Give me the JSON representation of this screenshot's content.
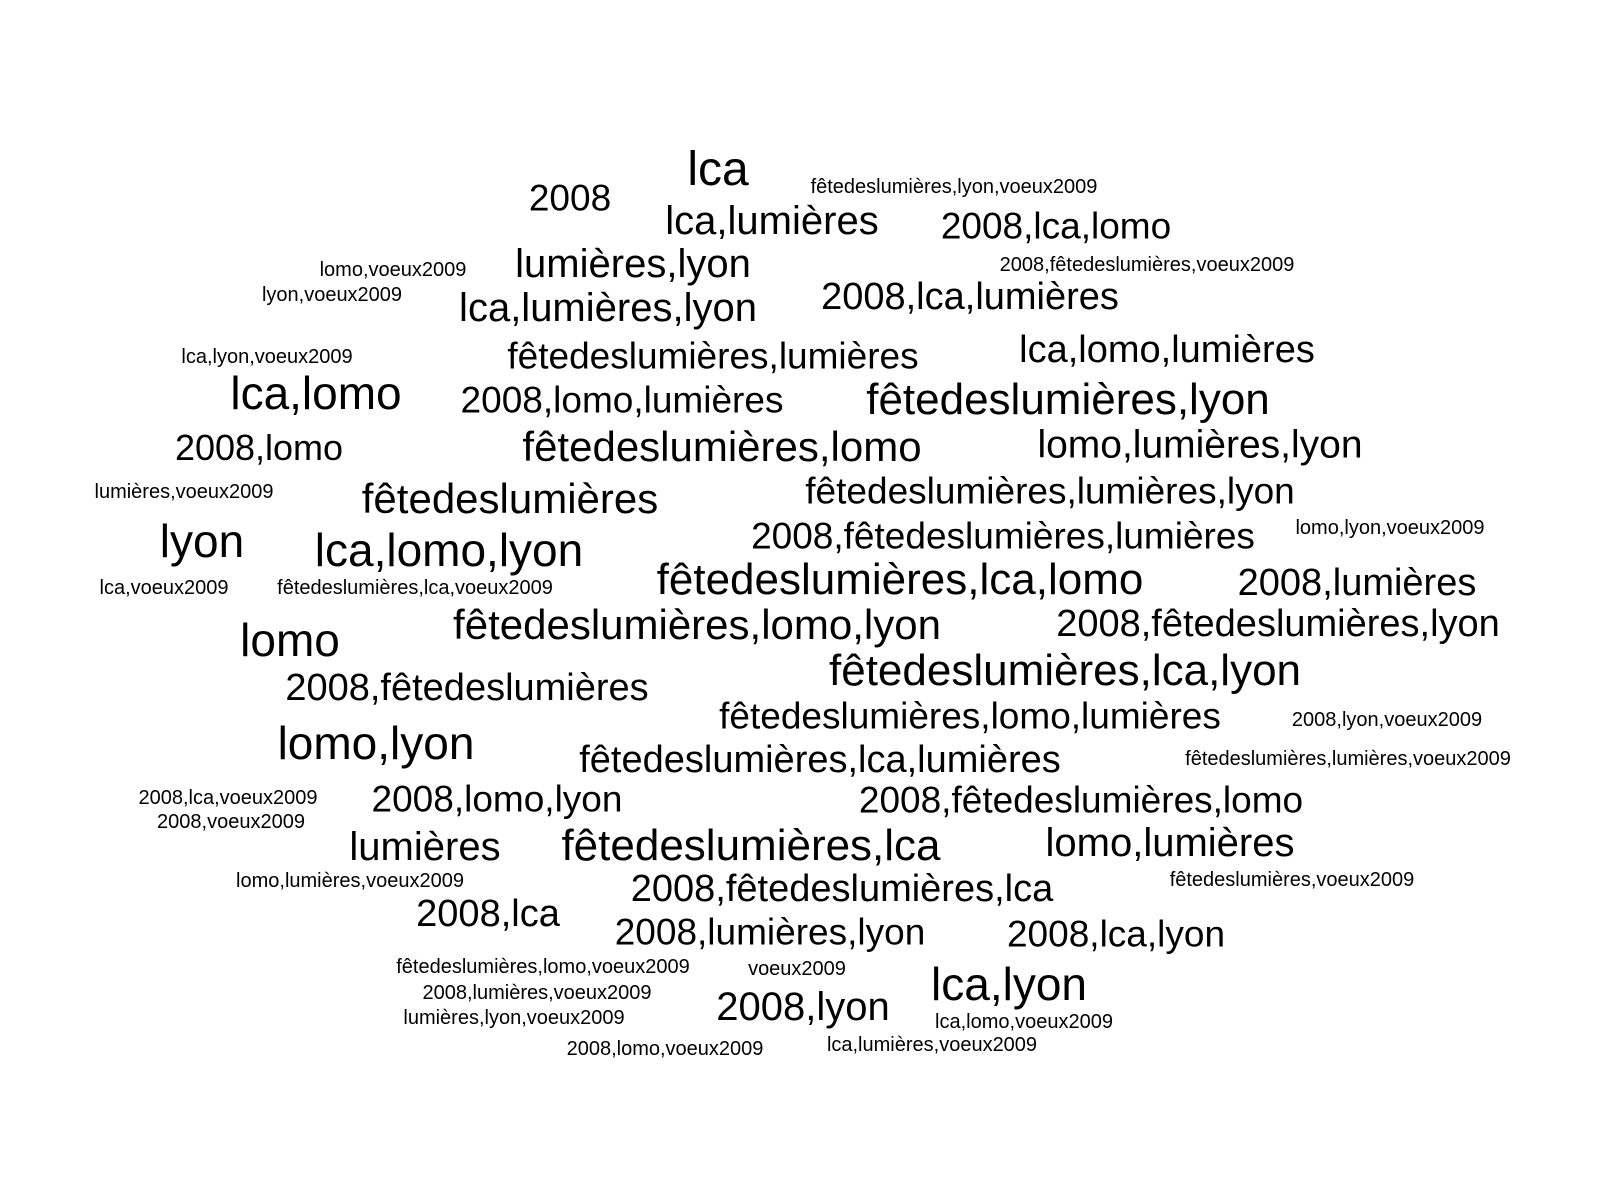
{
  "cloud": {
    "words": [
      {
        "text": "lca",
        "weight": 5
      },
      {
        "text": "2008",
        "weight": 4
      },
      {
        "text": "fêtedeslumières,lyon,voeux2009",
        "weight": 1
      },
      {
        "text": "lca,lumières",
        "weight": 4
      },
      {
        "text": "2008,lca,lomo",
        "weight": 3
      },
      {
        "text": "lumières,lyon",
        "weight": 4
      },
      {
        "text": "2008,fêtedeslumières,voeux2009",
        "weight": 1
      },
      {
        "text": "lomo,voeux2009",
        "weight": 1
      },
      {
        "text": "lyon,voeux2009",
        "weight": 1
      },
      {
        "text": "lca,lumières,lyon",
        "weight": 4
      },
      {
        "text": "2008,lca,lumières",
        "weight": 3
      },
      {
        "text": "lca,lyon,voeux2009",
        "weight": 1
      },
      {
        "text": "fêtedeslumières,lumières",
        "weight": 3
      },
      {
        "text": "lca,lomo,lumières",
        "weight": 3
      },
      {
        "text": "lca,lomo",
        "weight": 5
      },
      {
        "text": "2008,lomo,lumières",
        "weight": 3
      },
      {
        "text": "fêtedeslumières,lyon",
        "weight": 4
      },
      {
        "text": "2008,lomo",
        "weight": 3
      },
      {
        "text": "fêtedeslumières,lomo",
        "weight": 4
      },
      {
        "text": "lomo,lumières,lyon",
        "weight": 3
      },
      {
        "text": "lumières,voeux2009",
        "weight": 1
      },
      {
        "text": "fêtedeslumières",
        "weight": 4
      },
      {
        "text": "fêtedeslumières,lumières,lyon",
        "weight": 3
      },
      {
        "text": "lyon",
        "weight": 5
      },
      {
        "text": "lca,lomo,lyon",
        "weight": 5
      },
      {
        "text": "2008,fêtedeslumières,lumières",
        "weight": 3
      },
      {
        "text": "lomo,lyon,voeux2009",
        "weight": 1
      },
      {
        "text": "lca,voeux2009",
        "weight": 1
      },
      {
        "text": "fêtedeslumières,lca,voeux2009",
        "weight": 1
      },
      {
        "text": "fêtedeslumières,lca,lomo",
        "weight": 4
      },
      {
        "text": "2008,lumières",
        "weight": 3
      },
      {
        "text": "lomo",
        "weight": 5
      },
      {
        "text": "fêtedeslumières,lomo,lyon",
        "weight": 4
      },
      {
        "text": "2008,fêtedeslumières,lyon",
        "weight": 3
      },
      {
        "text": "fêtedeslumières,lca,lyon",
        "weight": 4
      },
      {
        "text": "2008,fêtedeslumières",
        "weight": 3
      },
      {
        "text": "fêtedeslumières,lomo,lumières",
        "weight": 3
      },
      {
        "text": "2008,lyon,voeux2009",
        "weight": 1
      },
      {
        "text": "lomo,lyon",
        "weight": 5
      },
      {
        "text": "fêtedeslumières,lca,lumières",
        "weight": 3
      },
      {
        "text": "fêtedeslumières,lumières,voeux2009",
        "weight": 1
      },
      {
        "text": "2008,lca,voeux2009",
        "weight": 1
      },
      {
        "text": "2008,lomo,lyon",
        "weight": 3
      },
      {
        "text": "2008,fêtedeslumières,lomo",
        "weight": 3
      },
      {
        "text": "2008,voeux2009",
        "weight": 1
      },
      {
        "text": "lumières",
        "weight": 4
      },
      {
        "text": "fêtedeslumières,lca",
        "weight": 4
      },
      {
        "text": "lomo,lumières",
        "weight": 4
      },
      {
        "text": "lomo,lumières,voeux2009",
        "weight": 1
      },
      {
        "text": "2008,fêtedeslumières,lca",
        "weight": 3
      },
      {
        "text": "fêtedeslumières,voeux2009",
        "weight": 1
      },
      {
        "text": "2008,lca",
        "weight": 4
      },
      {
        "text": "2008,lumières,lyon",
        "weight": 3
      },
      {
        "text": "2008,lca,lyon",
        "weight": 3
      },
      {
        "text": "fêtedeslumières,lomo,voeux2009",
        "weight": 1
      },
      {
        "text": "voeux2009",
        "weight": 1
      },
      {
        "text": "lca,lyon",
        "weight": 5
      },
      {
        "text": "2008,lumières,voeux2009",
        "weight": 1
      },
      {
        "text": "2008,lyon",
        "weight": 4
      },
      {
        "text": "lca,lomo,voeux2009",
        "weight": 1
      },
      {
        "text": "lumières,lyon,voeux2009",
        "weight": 1
      },
      {
        "text": "2008,lomo,voeux2009",
        "weight": 1
      },
      {
        "text": "lca,lumières,voeux2009",
        "weight": 1
      }
    ]
  }
}
